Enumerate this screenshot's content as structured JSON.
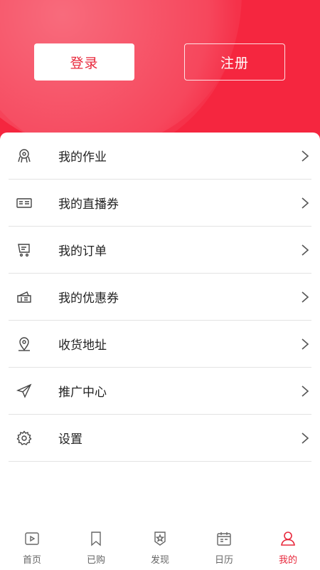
{
  "header": {
    "login_label": "登录",
    "register_label": "注册"
  },
  "menu": {
    "items": [
      {
        "label": "我的作业",
        "icon": "homework-icon"
      },
      {
        "label": "我的直播券",
        "icon": "ticket-icon"
      },
      {
        "label": "我的订单",
        "icon": "order-cart-icon"
      },
      {
        "label": "我的优惠券",
        "icon": "coupon-icon"
      },
      {
        "label": "收货地址",
        "icon": "location-pin-icon"
      },
      {
        "label": "推广中心",
        "icon": "paper-plane-icon"
      },
      {
        "label": "设置",
        "icon": "gear-icon"
      }
    ]
  },
  "tabbar": {
    "items": [
      {
        "label": "首页",
        "icon": "home-play-icon"
      },
      {
        "label": "已购",
        "icon": "bookmark-icon"
      },
      {
        "label": "发现",
        "icon": "badge-star-icon"
      },
      {
        "label": "日历",
        "icon": "calendar-icon"
      },
      {
        "label": "我的",
        "icon": "user-icon",
        "active": true
      }
    ]
  },
  "colors": {
    "brand": "#f5263f",
    "accent_text": "#e8283c",
    "divider": "#e3e3e3"
  }
}
